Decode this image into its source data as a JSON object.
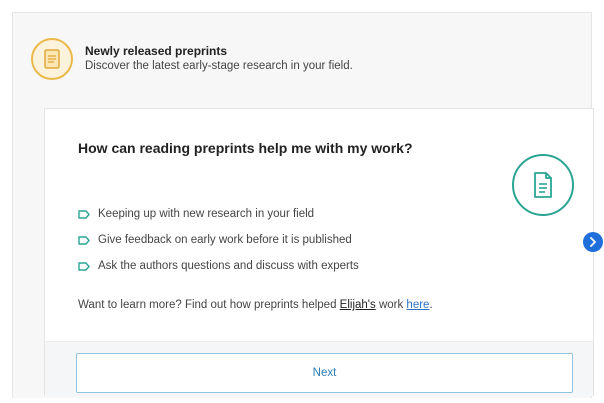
{
  "header": {
    "title": "Newly released preprints",
    "subtitle": "Discover the latest early-stage research in your field."
  },
  "card": {
    "question": "How can reading preprints help me with my work?",
    "bullets": [
      "Keeping up with new research in your field",
      "Give feedback on early work before it is published",
      "Ask the authors questions and discuss with experts"
    ],
    "learn_more": {
      "prefix": "Want to learn more? Find out how preprints helped ",
      "person": "Elijah's",
      "middle": " work ",
      "link": "here",
      "suffix": "."
    },
    "next_label": "Next"
  },
  "icons": {
    "header": "document-icon",
    "card": "document-icon",
    "bullet": "tag-icon",
    "carousel": "chevron-right-icon"
  },
  "colors": {
    "header_icon_ring": "#e9b94a",
    "card_icon_ring": "#2aa594",
    "link": "#2b73c9",
    "next_button_text": "#2e7db8",
    "carousel_button": "#1e6fd9"
  }
}
